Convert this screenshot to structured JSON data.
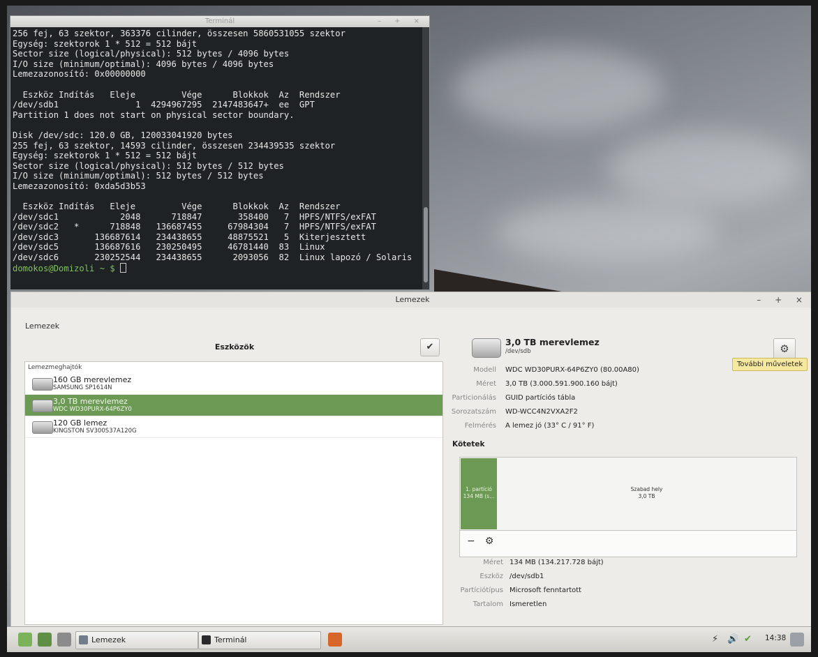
{
  "terminal": {
    "title": "Terminál",
    "lines": [
      "256 fej, 63 szektor, 363376 cilinder, összesen 5860531055 szektor",
      "Egység: szektorok 1 * 512 = 512 bájt",
      "Sector size (logical/physical): 512 bytes / 4096 bytes",
      "I/O size (minimum/optimal): 4096 bytes / 4096 bytes",
      "Lemezazonosító: 0x00000000",
      "",
      "  Eszköz Indítás   Eleje         Vége      Blokkok  Az  Rendszer",
      "/dev/sdb1               1  4294967295  2147483647+  ee  GPT",
      "Partition 1 does not start on physical sector boundary.",
      "",
      "Disk /dev/sdc: 120.0 GB, 120033041920 bytes",
      "255 fej, 63 szektor, 14593 cilinder, összesen 234439535 szektor",
      "Egység: szektorok 1 * 512 = 512 bájt",
      "Sector size (logical/physical): 512 bytes / 512 bytes",
      "I/O size (minimum/optimal): 512 bytes / 512 bytes",
      "Lemezazonosító: 0xda5d3b53",
      "",
      "  Eszköz Indítás   Eleje         Vége      Blokkok  Az  Rendszer",
      "/dev/sdc1            2048      718847       358400   7  HPFS/NTFS/exFAT",
      "/dev/sdc2   *      718848   136687455     67984304   7  HPFS/NTFS/exFAT",
      "/dev/sdc3       136687614   234438655     48875521   5  Kiterjesztett",
      "/dev/sdc5       136687616   230250495     46781440  83  Linux",
      "/dev/sdc6       230252544   234438655      2093056  82  Linux lapozó / Solaris"
    ],
    "prompt": "domokos@Domizoli ~ $ "
  },
  "disks": {
    "title": "Lemezek",
    "app_label": "Lemezek",
    "devices_header": "Eszközök",
    "group_label": "Lemezmeghajtók",
    "drives": [
      {
        "name": "160 GB merevlemez",
        "model": "SAMSUNG SP1614N"
      },
      {
        "name": "3,0 TB merevlemez",
        "model": "WDC WD30PURX-64P6ZY0"
      },
      {
        "name": "120 GB lemez",
        "model": "KINGSTON SV300S37A120G"
      }
    ],
    "selected": {
      "title": "3,0 TB merevlemez",
      "device": "/dev/sdb",
      "props": [
        {
          "label": "Modell",
          "value": "WDC WD30PURX-64P6ZY0 (80.00A80)"
        },
        {
          "label": "Méret",
          "value": "3,0 TB (3.000.591.900.160 bájt)"
        },
        {
          "label": "Particionálás",
          "value": "GUID partíciós tábla"
        },
        {
          "label": "Sorozatszám",
          "value": "WD-WCC4N2VXA2F2"
        },
        {
          "label": "Felmérés",
          "value": "A lemez jó (33° C / 91° F)"
        }
      ]
    },
    "more_actions_tooltip": "További műveletek",
    "volumes_header": "Kötetek",
    "partition1": {
      "line1": "1. partíció",
      "line2": "134 MB (s..."
    },
    "free_space": {
      "line1": "Szabad hely",
      "line2": "3,0 TB"
    },
    "vol_props": [
      {
        "label": "Méret",
        "value": "134 MB (134.217.728 bájt)"
      },
      {
        "label": "Eszköz",
        "value": "/dev/sdb1"
      },
      {
        "label": "Partíciótípus",
        "value": "Microsoft fenntartott"
      },
      {
        "label": "Tartalom",
        "value": "Ismeretlen"
      }
    ]
  },
  "taskbar": {
    "tasks": [
      {
        "label": "Lemezek"
      },
      {
        "label": "Terminál"
      }
    ],
    "clock": "14:38"
  },
  "colors": {
    "selection": "#6c9a54",
    "tooltip": "#f6e89f"
  }
}
